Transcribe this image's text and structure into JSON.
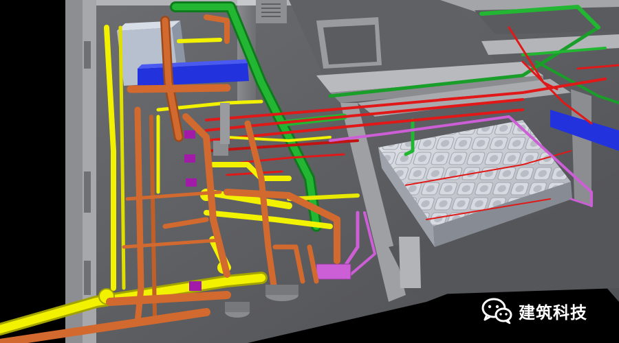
{
  "scene": {
    "subject": "bim-mep-pipe-model",
    "colors": {
      "background": "#000000",
      "slab": "#5f6064",
      "wall_top": "#b8b9bd",
      "wall_side": "#7d7e82",
      "water_supply": "#f2f200",
      "drainage": "#d2692e",
      "fire": "#e01818",
      "ventilation": "#1a9e2a",
      "duct": "#2233dd",
      "hot_water": "#cc5fd6",
      "tank": "#c9ccd2"
    }
  },
  "watermark": {
    "icon": "wechat-icon",
    "text": "建筑科技"
  }
}
